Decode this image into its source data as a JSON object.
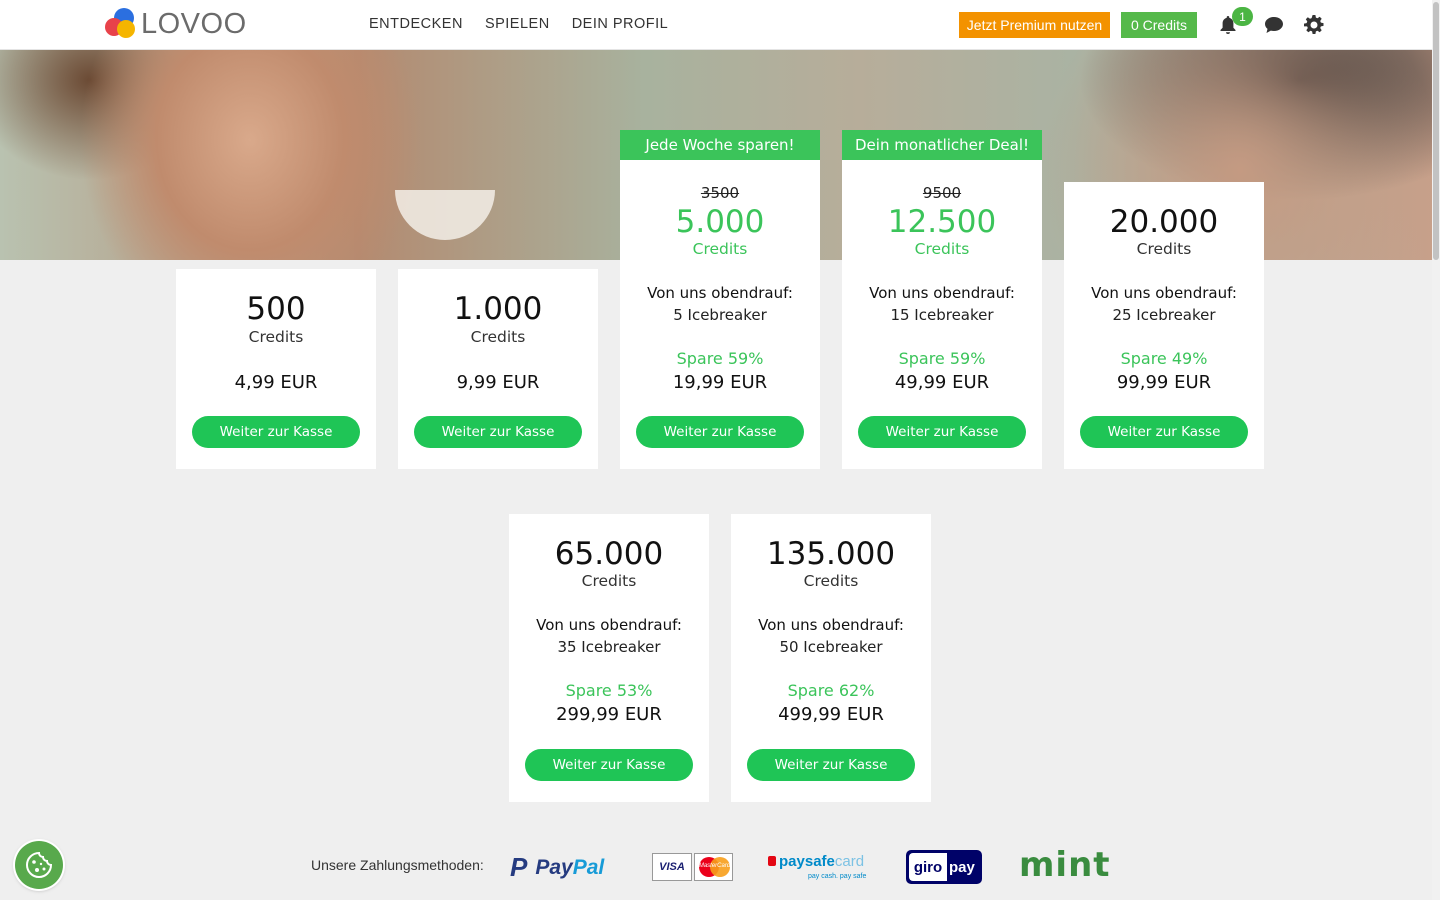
{
  "header": {
    "logo_text": "LOVOO",
    "nav": [
      "ENTDECKEN",
      "SPIELEN",
      "DEIN PROFIL"
    ],
    "premium_label": "Jetzt Premium nutzen",
    "credits_label": "0 Credits",
    "notification_count": "1",
    "icons": [
      "bell-icon",
      "chat-bubble-icon",
      "gear-icon"
    ]
  },
  "packages": [
    {
      "amount": "500",
      "unit": "Credits",
      "price": "4,99 EUR",
      "cta": "Weiter zur Kasse"
    },
    {
      "amount": "1.000",
      "unit": "Credits",
      "price": "9,99 EUR",
      "cta": "Weiter zur Kasse"
    },
    {
      "ribbon": "Jede Woche sparen!",
      "old_amount": "3500",
      "amount": "5.000",
      "unit": "Credits",
      "bonus_title": "Von uns obendrauf:",
      "bonus": "5 Icebreaker",
      "save": "Spare 59%",
      "price": "19,99 EUR",
      "cta": "Weiter zur Kasse"
    },
    {
      "ribbon": "Dein monatlicher Deal!",
      "old_amount": "9500",
      "amount": "12.500",
      "unit": "Credits",
      "bonus_title": "Von uns obendrauf:",
      "bonus": "15 Icebreaker",
      "save": "Spare 59%",
      "price": "49,99 EUR",
      "cta": "Weiter zur Kasse"
    },
    {
      "amount": "20.000",
      "unit": "Credits",
      "bonus_title": "Von uns obendrauf:",
      "bonus": "25 Icebreaker",
      "save": "Spare 49%",
      "price": "99,99 EUR",
      "cta": "Weiter zur Kasse"
    },
    {
      "amount": "65.000",
      "unit": "Credits",
      "bonus_title": "Von uns obendrauf:",
      "bonus": "35 Icebreaker",
      "save": "Spare 53%",
      "price": "299,99 EUR",
      "cta": "Weiter zur Kasse"
    },
    {
      "amount": "135.000",
      "unit": "Credits",
      "bonus_title": "Von uns obendrauf:",
      "bonus": "50 Icebreaker",
      "save": "Spare 62%",
      "price": "499,99 EUR",
      "cta": "Weiter zur Kasse"
    }
  ],
  "payments": {
    "label": "Unsere Zahlungsmethoden:",
    "paypal": [
      "Pay",
      "Pal"
    ],
    "visa": "VISA",
    "mastercard": "MasterCard",
    "paysafecard": [
      "paysafe",
      "card"
    ],
    "paysafecard_sub": "pay cash. pay safe",
    "giropay": [
      "giro",
      "pay"
    ],
    "mint": "mint"
  },
  "colors": {
    "accent_green": "#3bc45a",
    "button_green": "#1fc556",
    "premium_orange": "#f39200",
    "credits_green": "#55b94a"
  }
}
